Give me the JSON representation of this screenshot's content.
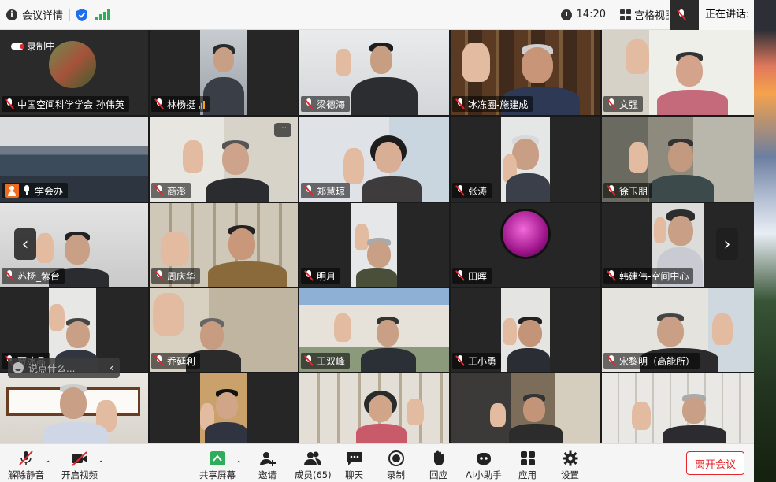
{
  "topbar": {
    "meeting_info": "会议详情",
    "time": "14:20",
    "view": "宫格视图",
    "speaking": "正在讲话:"
  },
  "recording_label": "录制中",
  "chat_placeholder": "说点什么...",
  "tiles": [
    {
      "name": "中国空间科学学会 孙伟英",
      "mic": "off"
    },
    {
      "name": "林杨挺",
      "mic": "off",
      "signal": true
    },
    {
      "name": "梁德海",
      "mic": "off"
    },
    {
      "name": "冰冻圈-施建成",
      "mic": "off"
    },
    {
      "name": "文强",
      "mic": "off"
    },
    {
      "name": "学会办",
      "mic": "on",
      "user_icon": true
    },
    {
      "name": "商澎",
      "mic": "off"
    },
    {
      "name": "郑慧琼",
      "mic": "off"
    },
    {
      "name": "张涛",
      "mic": "off"
    },
    {
      "name": "徐玉朋",
      "mic": "off"
    },
    {
      "name": "苏杨_紫台",
      "mic": "off"
    },
    {
      "name": "周庆华",
      "mic": "off"
    },
    {
      "name": "明月",
      "mic": "off"
    },
    {
      "name": "田晖",
      "mic": "off"
    },
    {
      "name": "韩建伟-空间中心",
      "mic": "off"
    },
    {
      "name": "贾冰晶",
      "mic": "off"
    },
    {
      "name": "乔延利",
      "mic": "off"
    },
    {
      "name": "王双峰",
      "mic": "off"
    },
    {
      "name": "王小勇",
      "mic": "off"
    },
    {
      "name": "宋黎明（高能所）",
      "mic": "off"
    }
  ],
  "toolbar": {
    "unmute": "解除静音",
    "start_video": "开启视频",
    "share_screen": "共享屏幕",
    "invite": "邀请",
    "members": "成员(65)",
    "chat": "聊天",
    "record": "录制",
    "reactions": "回应",
    "ai_assistant": "AI小助手",
    "apps": "应用",
    "settings": "设置",
    "leave": "离开会议"
  },
  "colors": {
    "accent_red": "#e5252a",
    "signal_green": "#2cae5a",
    "shield_blue": "#1e6ff0",
    "share_green": "#2cae5a"
  }
}
